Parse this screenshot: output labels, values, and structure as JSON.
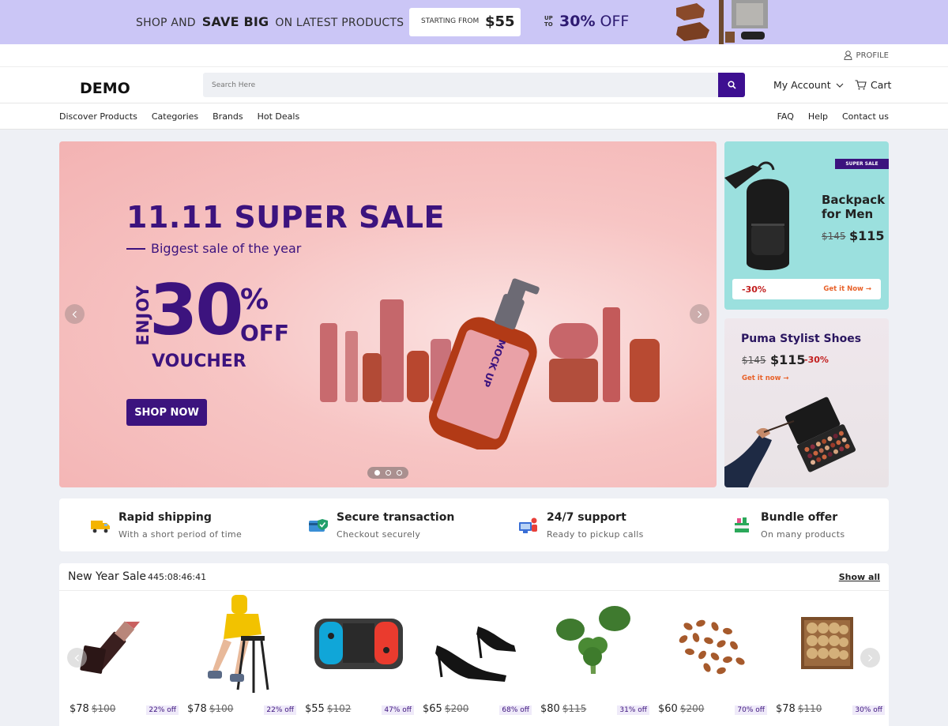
{
  "promo": {
    "shop_and": "SHOP AND",
    "save_big": "SAVE BIG",
    "on_latest": "ON LATEST PRODUCTS",
    "starting_from": "STARTING FROM",
    "starting_price": "$55",
    "up_to": "UP TO",
    "off_percent": "30%",
    "off_word": "OFF",
    "bg_color": "#cbc6f6"
  },
  "util": {
    "profile_label": "PROFILE"
  },
  "header": {
    "logo": "DEMO",
    "search_placeholder": "Search Here",
    "account_label": "My Account",
    "cart_label": "Cart",
    "accent_color": "#3d0f91"
  },
  "nav": {
    "left": [
      "Discover Products",
      "Categories",
      "Brands",
      "Hot Deals"
    ],
    "right": [
      "FAQ",
      "Help",
      "Contact us"
    ]
  },
  "hero": {
    "title": "11.11 SUPER SALE",
    "subtitle": "Biggest sale of the year",
    "enjoy": "ENJOY",
    "big_number": "30",
    "percent": "%",
    "off": "OFF",
    "voucher": "VOUCHER",
    "cta": "SHOP NOW",
    "bottle_label": "MOCK UP",
    "slides": 3,
    "active_slide": 1
  },
  "side_banners": [
    {
      "tag": "SUPER SALE",
      "title": "Backpack for Men",
      "old_price": "$145",
      "new_price": "$115",
      "discount": "-30%",
      "cta": "Get it Now →",
      "bg_color": "#9be0de"
    },
    {
      "title": "Puma Stylist Shoes",
      "old_price": "$145",
      "new_price": "$115",
      "discount": "-30%",
      "cta": "Get it now →"
    }
  ],
  "features": [
    {
      "title": "Rapid shipping",
      "subtitle": "With a short period of time",
      "icon": "truck-icon"
    },
    {
      "title": "Secure transaction",
      "subtitle": "Checkout securely",
      "icon": "secure-card-icon"
    },
    {
      "title": "24/7 support",
      "subtitle": "Ready to pickup calls",
      "icon": "support-agent-icon"
    },
    {
      "title": "Bundle offer",
      "subtitle": "On many products",
      "icon": "bundle-box-icon"
    }
  ],
  "sale": {
    "title": "New Year Sale",
    "timer": "445:08:46:41",
    "show_all": "Show all",
    "products": [
      {
        "name": "lipstick",
        "price": "$78",
        "old_price": "$100",
        "discount": "22% off"
      },
      {
        "name": "stool model",
        "price": "$78",
        "old_price": "$100",
        "discount": "22% off"
      },
      {
        "name": "game controller",
        "price": "$55",
        "old_price": "$102",
        "discount": "47% off"
      },
      {
        "name": "heels",
        "price": "$65",
        "old_price": "$200",
        "discount": "68% off"
      },
      {
        "name": "broccoli",
        "price": "$80",
        "old_price": "$115",
        "discount": "31% off"
      },
      {
        "name": "almonds",
        "price": "$60",
        "old_price": "$200",
        "discount": "70% off"
      },
      {
        "name": "walnuts",
        "price": "$78",
        "old_price": "$110",
        "discount": "30% off"
      }
    ]
  }
}
